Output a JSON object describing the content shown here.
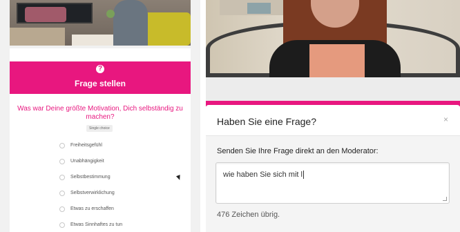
{
  "left": {
    "panel_title": "Frage stellen",
    "question": "Was war Deine größte Motivation, Dich selbständig zu machen?",
    "choice_type": "Single choice",
    "options": [
      "Freiheitsgefühl",
      "Unabhängigkeit",
      "Selbstbestimmung",
      "Selbstverwirklichung",
      "Etwas zu erschaffen",
      "Etwas Sinnhaftes zu tun"
    ]
  },
  "modal": {
    "title": "Haben Sie eine Frage?",
    "close_glyph": "×",
    "label": "Senden Sie Ihre Frage direkt an den Moderator:",
    "input_value": "wie haben Sie sich mit l",
    "chars_left": "476 Zeichen übrig."
  },
  "icons": {
    "help": "question-circle-icon",
    "close": "close-icon",
    "cursor": "mouse-pointer-icon"
  },
  "colors": {
    "accent": "#e8177f",
    "panel_bg": "#f1f1f1",
    "modal_body_bg": "#f4f4f4"
  }
}
